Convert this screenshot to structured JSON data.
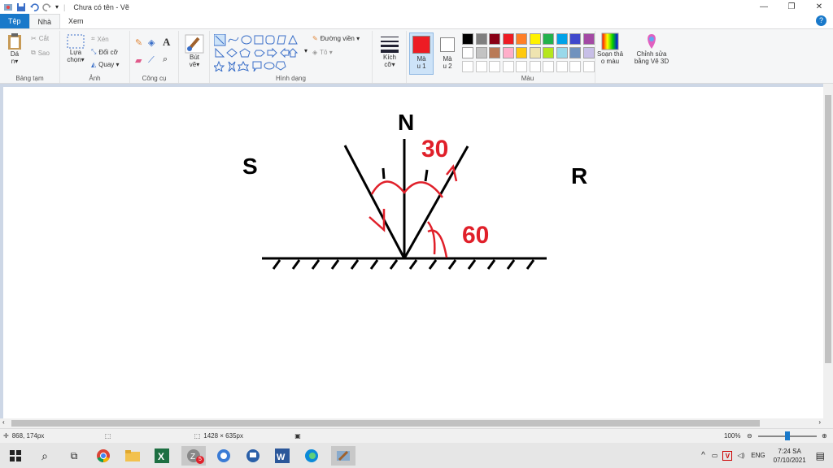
{
  "titlebar": {
    "title": "Chưa có tên - Vẽ",
    "minimize": "—",
    "maximize": "❐",
    "close": "✕"
  },
  "tabs": {
    "file": "Tệp",
    "home": "Nhà",
    "view": "Xem"
  },
  "ribbon": {
    "clipboard": {
      "paste": "Dá\nn▾",
      "cut": "Cắt",
      "copy": "Sao",
      "label": "Bảng tạm"
    },
    "image": {
      "select": "Lựa\nchọn▾",
      "crop": "Xén",
      "resize": "Đổi cỡ",
      "rotate": "Quay ▾",
      "label": "Ảnh"
    },
    "tools": {
      "label": "Công cụ"
    },
    "brushes": {
      "label": "Bút\nvẽ▾"
    },
    "shapes": {
      "outline": "Đường viền ▾",
      "fill": "Tô ▾",
      "label": "Hình dạng"
    },
    "size": {
      "label": "Kích\ncỡ▾"
    },
    "color1": {
      "label": "Mà\nu 1",
      "value": "#ed1c24"
    },
    "color2": {
      "label": "Mà\nu 2",
      "value": "#ffffff"
    },
    "colors_label": "Màu",
    "edit_colors": "Soạn thả\no màu",
    "paint3d": "Chỉnh sửa\nbằng Vẽ 3D",
    "palette_row1": [
      "#000000",
      "#7f7f7f",
      "#880015",
      "#ed1c24",
      "#ff7f27",
      "#fff200",
      "#22b14c",
      "#00a2e8",
      "#3f48cc",
      "#a349a4"
    ],
    "palette_row2": [
      "#ffffff",
      "#c3c3c3",
      "#b97a57",
      "#ffaec9",
      "#ffc90e",
      "#efe4b0",
      "#b5e61d",
      "#99d9ea",
      "#7092be",
      "#c8bfe7"
    ]
  },
  "canvas_text": {
    "S": "S",
    "N": "N",
    "R": "R",
    "angle30": "30",
    "angle60": "60"
  },
  "colors": {
    "ink": "#000000",
    "accent": "#e0202a"
  },
  "status": {
    "cursor": "868, 174px",
    "size": "1428 × 635px",
    "zoom": "100%"
  },
  "tray": {
    "lang": "ENG",
    "time": "7:24 SA",
    "date": "07/10/2021",
    "badge": "5"
  }
}
